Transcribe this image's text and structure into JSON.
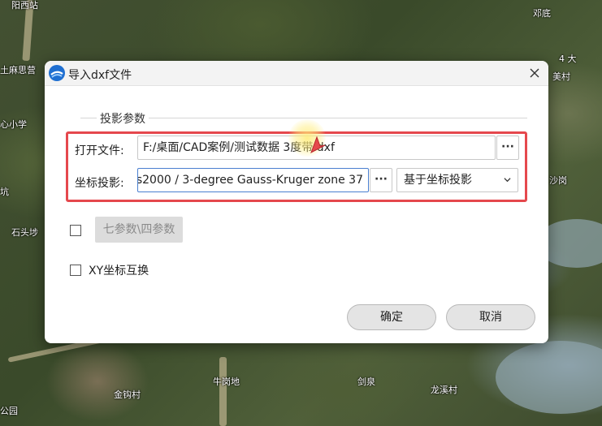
{
  "map": {
    "labels": [
      "阳西站",
      "邓底",
      "土麻思营",
      "心小学",
      "坑",
      "石头埗",
      "4 大",
      "美村",
      "沙岗",
      "牛岗地",
      "剑泉",
      "金钩村",
      "龙溪村",
      "公园"
    ]
  },
  "dialog": {
    "title": "导入dxf文件",
    "group_title": "投影参数",
    "open_file_label": "打开文件:",
    "file_path": "F:/桌面/CAD案例/测试数据 3度带.dxf",
    "coord_label": "坐标投影:",
    "coord_value": "s2000 / 3-degree Gauss-Kruger zone 37",
    "browse_label": "···",
    "projection_mode": "基于坐标投影",
    "seven_param_label": "七参数\\四参数",
    "xy_swap_label": "XY坐标互换",
    "ok_label": "确定",
    "cancel_label": "取消"
  },
  "colors": {
    "highlight": "#e5484d",
    "active_border": "#4a7fd0"
  }
}
